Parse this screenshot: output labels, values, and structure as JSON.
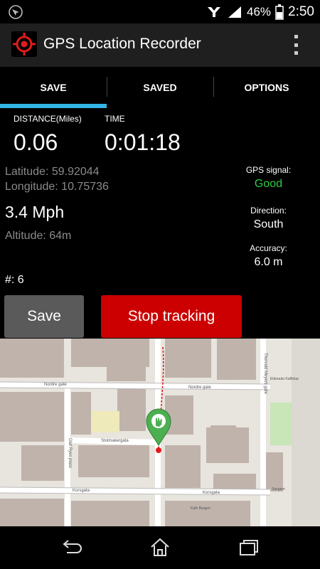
{
  "status_bar": {
    "battery_percent": "46%",
    "time": "2:50",
    "icons": [
      "gps-icon",
      "nfc-icon",
      "signal-icon",
      "battery-icon"
    ]
  },
  "app_bar": {
    "title": "GPS Location Recorder",
    "icon": "crosshair-icon",
    "menu_icon": "overflow-menu-icon"
  },
  "tabs": [
    {
      "label": "SAVE",
      "active": true
    },
    {
      "label": "SAVED",
      "active": false
    },
    {
      "label": "OPTIONS",
      "active": false
    }
  ],
  "stats": {
    "distance_label": "DISTANCE(Miles)",
    "distance_value": "0.06",
    "time_label": "TIME",
    "time_value": "0:01:18",
    "latitude": "Latitude: 59.92044",
    "longitude": "Longitude: 10.75736",
    "speed": "3.4 Mph",
    "altitude": "Altitude: 64m",
    "point_count": "#: 6",
    "gps_signal_label": "GPS signal:",
    "gps_signal_value": "Good",
    "direction_label": "Direction:",
    "direction_value": "South",
    "accuracy_label": "Accuracy:",
    "accuracy_value": "6.0 m"
  },
  "buttons": {
    "save": "Save",
    "stop": "Stop tracking"
  },
  "map": {
    "streets": {
      "nordre": "Nordre gate",
      "nordre_right": "Nordre gate",
      "olaf": "Olaf Ryes plass",
      "stolmakergata": "Stolmakergata",
      "korsgata_left": "Korsgata",
      "korsgata_right": "Korsgata",
      "thorvald": "Thorvald Meyers gate"
    },
    "pois": {
      "eldorado": "Eldorado Kaffebar",
      "kafe": "Kafe Bergen",
      "sangam": "Sangam"
    }
  },
  "colors": {
    "accent": "#33b5e5",
    "good": "#2ecc40",
    "stop": "#cc0000",
    "marker": "#4caf50"
  },
  "nav_bar": {
    "back": "back-icon",
    "home": "home-icon",
    "recents": "recents-icon"
  }
}
